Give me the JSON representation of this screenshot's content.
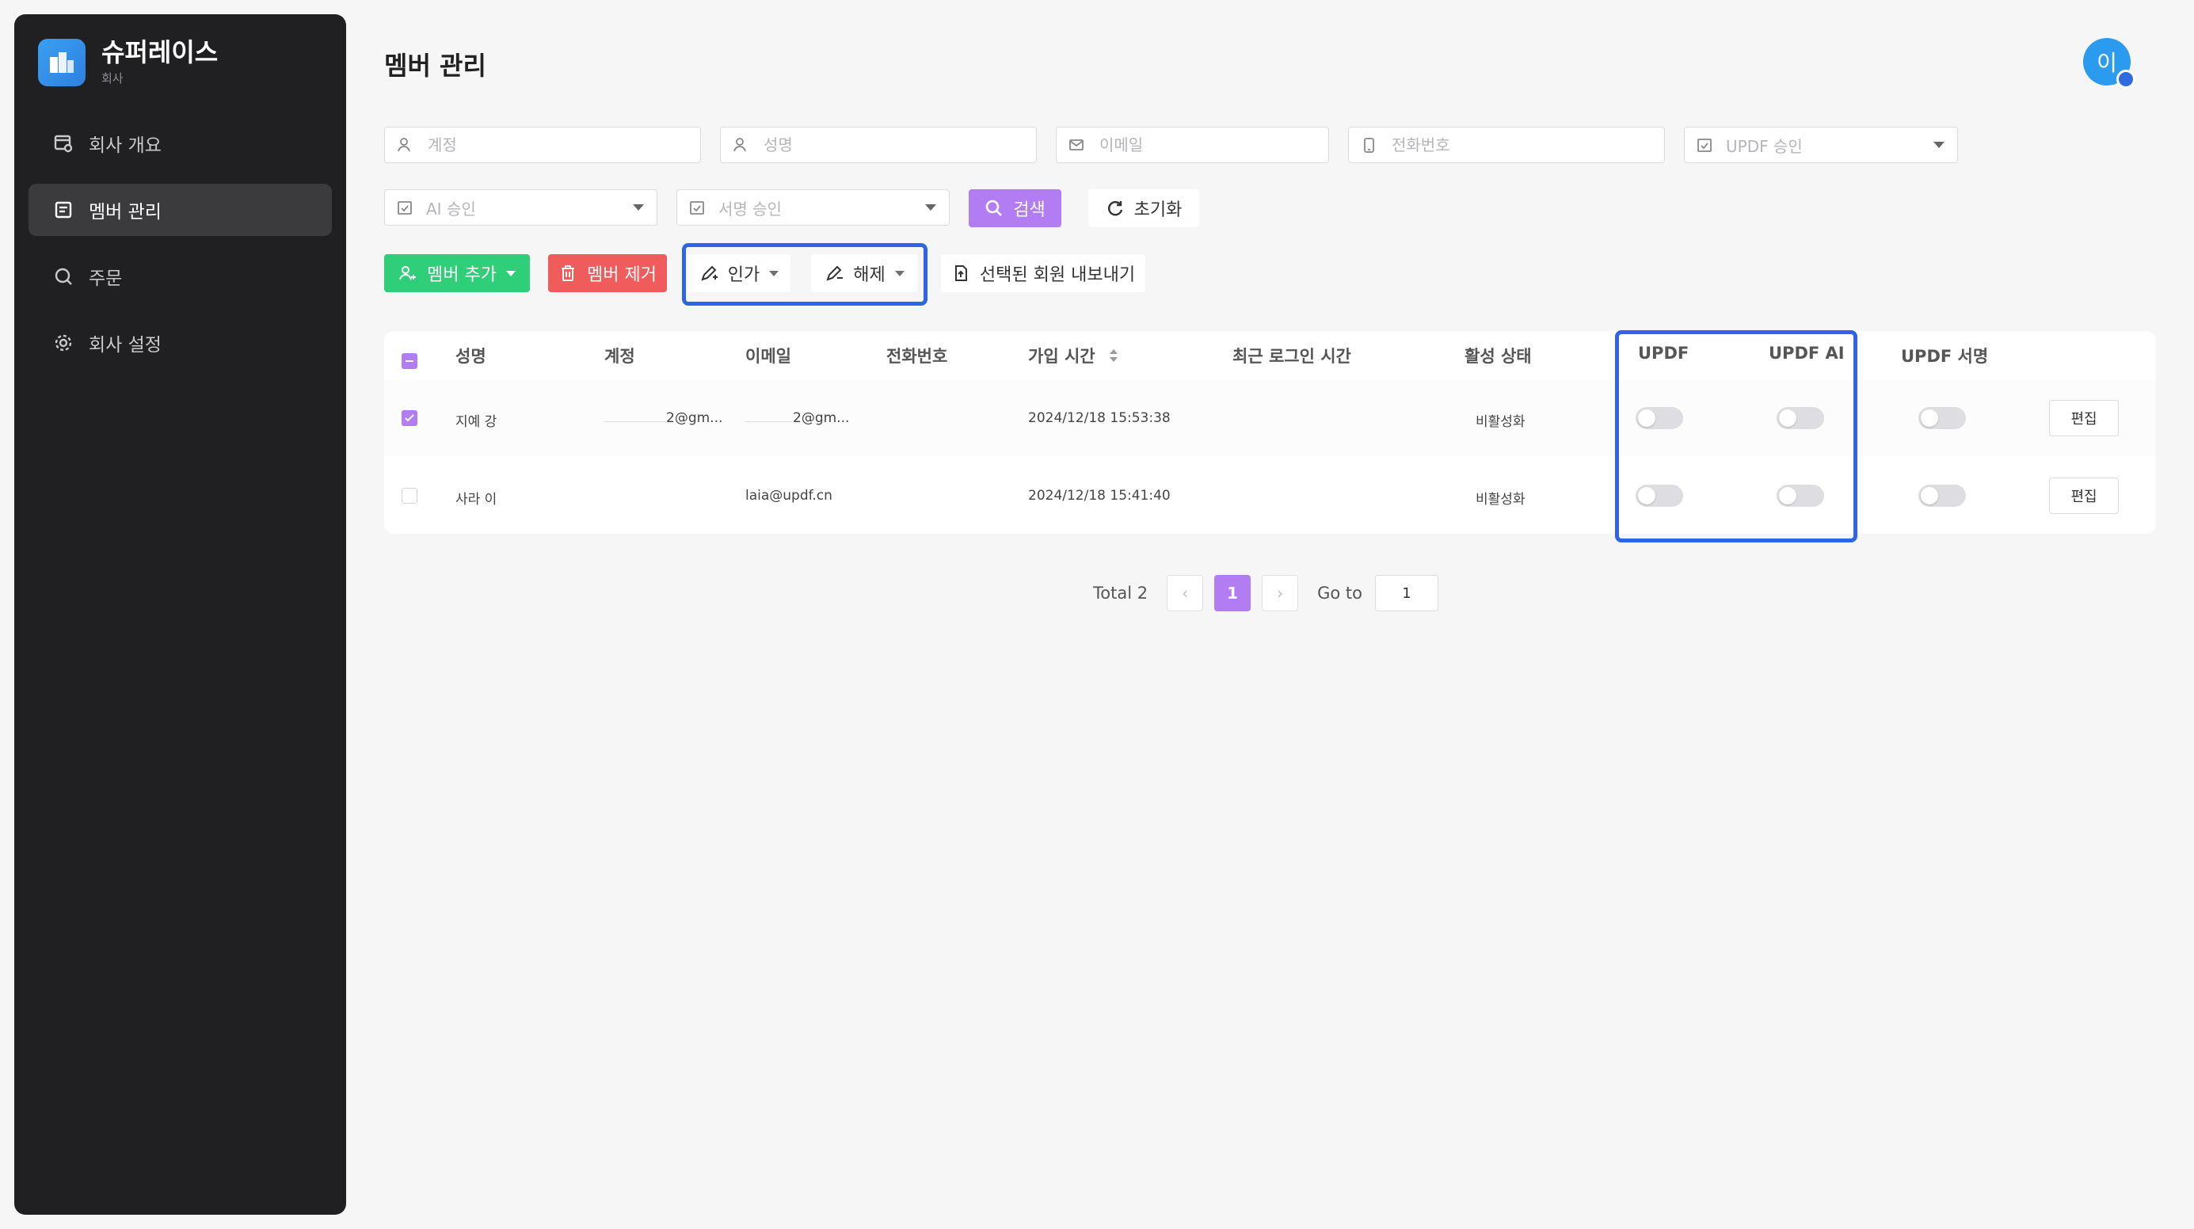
{
  "sidebar": {
    "brand_name": "슈퍼레이스",
    "brand_sub": "회사",
    "items": [
      {
        "label": "회사 개요"
      },
      {
        "label": "멤버 관리"
      },
      {
        "label": "주문"
      },
      {
        "label": "회사 설정"
      }
    ]
  },
  "header": {
    "title": "멤버 관리",
    "avatar_initial": "이"
  },
  "filters": {
    "account_placeholder": "계정",
    "name_placeholder": "성명",
    "email_placeholder": "이메일",
    "phone_placeholder": "전화번호",
    "updf_approval": "UPDF 승인",
    "ai_approval": "AI 승인",
    "sign_approval": "서명 승인",
    "search_label": "검색",
    "reset_label": "초기화"
  },
  "actions": {
    "add_member": "멤버 추가",
    "remove_member": "멤버 제거",
    "grant": "인가",
    "revoke": "해제",
    "export": "선택된 회원 내보내기"
  },
  "table": {
    "headers": {
      "name": "성명",
      "account": "계정",
      "email": "이메일",
      "phone": "전화번호",
      "joined": "가입 시간",
      "last_login": "최근 로그인 시간",
      "status": "활성 상태",
      "updf": "UPDF",
      "updf_ai": "UPDF AI",
      "updf_sign": "UPDF 서명"
    },
    "rows": [
      {
        "name": "지예 강",
        "account": "2@gm...",
        "email": "2@gm...",
        "phone": "",
        "joined": "2024/12/18 15:53:38",
        "last_login": "",
        "status": "비활성화",
        "edit": "편집",
        "checked": true
      },
      {
        "name": "사라 이",
        "account": "",
        "email": "laia@updf.cn",
        "phone": "",
        "joined": "2024/12/18 15:41:40",
        "last_login": "",
        "status": "비활성화",
        "edit": "편집",
        "checked": false
      }
    ]
  },
  "pagination": {
    "total": "Total 2",
    "current_page": "1",
    "goto_label": "Go to",
    "goto_value": "1"
  },
  "colors": {
    "accent": "#b27cf2",
    "highlight": "#2f64e8",
    "add": "#2fcf7a",
    "remove": "#f05c5c"
  }
}
